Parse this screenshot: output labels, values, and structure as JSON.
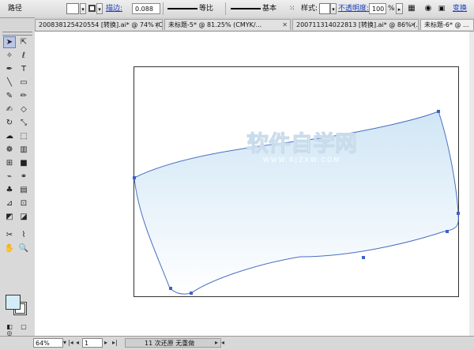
{
  "control_bar": {
    "object_label": "路径",
    "stroke_label": "描边:",
    "stroke_weight": "0.088",
    "stroke_profile": "等比",
    "brush_label": "基本",
    "style_label": "样式:",
    "opacity_label": "不透明度:",
    "opacity_value": "100",
    "opacity_unit": "%",
    "transform_label": "变换"
  },
  "tabs": [
    {
      "label": "200838125420554 [转换].ai* @ 74% (C..."
    },
    {
      "label": "未标题-5* @ 81.25% (CMYK/..."
    },
    {
      "label": "200711314022813 [转换].ai* @ 86% (..."
    },
    {
      "label": "未标题-6* @ ..."
    }
  ],
  "tools": [
    {
      "name": "selection-tool-icon",
      "glyph": "➤"
    },
    {
      "name": "direct-selection-tool-icon",
      "glyph": "⇱"
    },
    {
      "name": "magic-wand-tool-icon",
      "glyph": "✧"
    },
    {
      "name": "lasso-tool-icon",
      "glyph": "ℓ"
    },
    {
      "name": "pen-tool-icon",
      "glyph": "✒"
    },
    {
      "name": "type-tool-icon",
      "glyph": "T"
    },
    {
      "name": "line-segment-tool-icon",
      "glyph": "╲"
    },
    {
      "name": "rectangle-tool-icon",
      "glyph": "▭"
    },
    {
      "name": "paintbrush-tool-icon",
      "glyph": "✎"
    },
    {
      "name": "pencil-tool-icon",
      "glyph": "✏"
    },
    {
      "name": "blob-brush-tool-icon",
      "glyph": "✍"
    },
    {
      "name": "eraser-tool-icon",
      "glyph": "◇"
    },
    {
      "name": "rotate-tool-icon",
      "glyph": "↻"
    },
    {
      "name": "scale-tool-icon",
      "glyph": "⤡"
    },
    {
      "name": "warp-tool-icon",
      "glyph": "☁"
    },
    {
      "name": "free-transform-tool-icon",
      "glyph": "⬚"
    },
    {
      "name": "symbol-sprayer-tool-icon",
      "glyph": "❁"
    },
    {
      "name": "column-graph-tool-icon",
      "glyph": "▥"
    },
    {
      "name": "mesh-tool-icon",
      "glyph": "⊞"
    },
    {
      "name": "gradient-tool-icon",
      "glyph": "■"
    },
    {
      "name": "eyedropper-tool-icon",
      "glyph": "⌁"
    },
    {
      "name": "blend-tool-icon",
      "glyph": "⚭"
    },
    {
      "name": "symbol-tool-icon",
      "glyph": "♣"
    },
    {
      "name": "graph-tool-icon",
      "glyph": "▤"
    },
    {
      "name": "live-paint-tool-icon",
      "glyph": "⊿"
    },
    {
      "name": "live-paint-selection-icon",
      "glyph": "⊡"
    },
    {
      "name": "artboard-tool-icon",
      "glyph": "◩"
    },
    {
      "name": "slice-tool-icon",
      "glyph": "◪"
    },
    {
      "name": "scissors-tool-icon",
      "glyph": "✂"
    },
    {
      "name": "knife-tool-icon",
      "glyph": "⌇"
    },
    {
      "name": "hand-tool-icon",
      "glyph": "✋"
    },
    {
      "name": "zoom-tool-icon",
      "glyph": "🔍"
    }
  ],
  "watermark": {
    "title": "软件自学网",
    "url": "WWW.RJZXW.COM"
  },
  "colors": {
    "fill_top": "#d0e6f5",
    "fill_bottom": "#ffffff",
    "path_stroke": "#4a6fc4",
    "anchor": "#3b62c8"
  },
  "status": {
    "zoom": "64%",
    "page": "1",
    "history": "11 次还原 ",
    "redo": "无重做"
  }
}
